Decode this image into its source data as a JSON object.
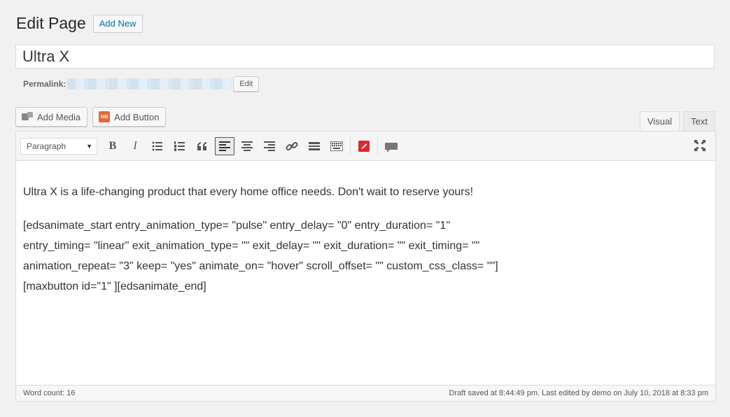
{
  "header": {
    "title": "Edit Page",
    "add_new_label": "Add New"
  },
  "post_title": {
    "value": "Ultra X"
  },
  "permalink": {
    "label": "Permalink:",
    "edit_label": "Edit"
  },
  "media_buttons": {
    "add_media": "Add Media",
    "add_button": "Add Button",
    "mb_badge": "MB"
  },
  "editor_tabs": {
    "visual": "Visual",
    "text": "Text",
    "active": "Visual"
  },
  "toolbar": {
    "format_select": "Paragraph",
    "buttons": [
      "bold",
      "italic",
      "bulleted-list",
      "numbered-list",
      "blockquote",
      "align-left",
      "align-center",
      "align-right",
      "insert-link",
      "read-more",
      "toolbar-toggle",
      "maxbuttons",
      "comment"
    ],
    "active_button": "align-left"
  },
  "content": {
    "paragraph1": "Ultra X is a life-changing product that every home office needs. Don't wait to reserve yours!",
    "paragraph2": "[edsanimate_start entry_animation_type= \"pulse\" entry_delay= \"0\" entry_duration= \"1\" entry_timing= \"linear\" exit_animation_type= \"\" exit_delay= \"\" exit_duration= \"\" exit_timing= \"\" animation_repeat= \"3\" keep= \"yes\" animate_on= \"hover\" scroll_offset= \"\" custom_css_class= \"\"][maxbutton id=\"1\" ][edsanimate_end]"
  },
  "status": {
    "word_count": "Word count: 16",
    "draft_saved": "Draft saved at 8:44:49 pm. Last edited by demo on July 10, 2018 at 8:33 pm"
  },
  "colors": {
    "link": "#0073aa",
    "maxbuttons_icon": "#e0262f",
    "mb_badge": "#e8663b"
  }
}
